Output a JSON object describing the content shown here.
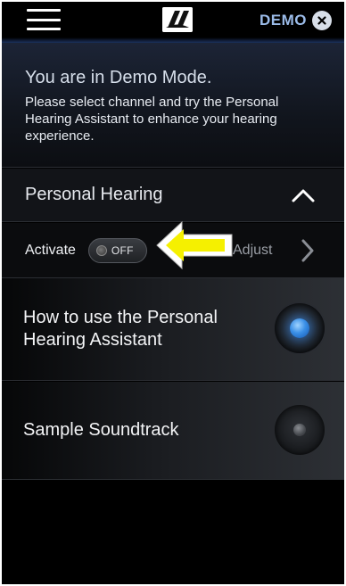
{
  "topbar": {
    "menu_icon": "hamburger-menu-icon",
    "logo_icon": "sennheiser-logo-icon",
    "demo_label": "DEMO",
    "demo_close_icon": "close-circle-icon"
  },
  "message": {
    "title": "You are in Demo Mode.",
    "body": "Please select channel and try the Personal Hearing Assistant to enhance your hearing experience."
  },
  "personal_hearing": {
    "label": "Personal Hearing",
    "toggle_icon": "chevron-up-icon",
    "activate_label": "Activate",
    "switch_state": "OFF",
    "adjust_label": "Adjust",
    "adjust_icon": "chevron-right-icon",
    "annotation_icon": "yellow-arrow-icon"
  },
  "channels": [
    {
      "label": "How to use the Personal Hearing Assistant",
      "selected": true
    },
    {
      "label": "Sample Soundtrack",
      "selected": false
    }
  ],
  "colors": {
    "accent_blue": "#3a8fe6",
    "demo_text": "#9bbbe8",
    "arrow_yellow": "#f5f000"
  }
}
